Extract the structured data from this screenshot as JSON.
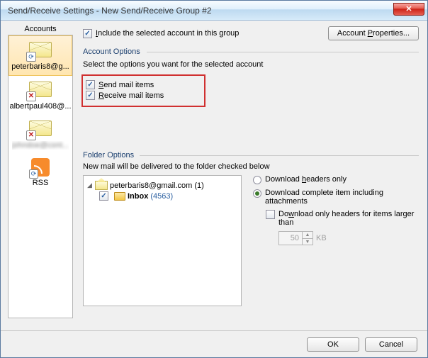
{
  "window": {
    "title": "Send/Receive Settings - New Send/Receive Group #2"
  },
  "sidebar": {
    "header": "Accounts",
    "items": [
      {
        "label": "peterbaris8@g...",
        "selected": true,
        "badge": "refresh"
      },
      {
        "label": "albertpaul408@...",
        "selected": false,
        "badge": "error"
      },
      {
        "label": "johndoe@cont...",
        "selected": false,
        "badge": "error",
        "blurred": true
      },
      {
        "label": "RSS",
        "selected": false,
        "icon": "rss"
      }
    ]
  },
  "main": {
    "include_label": "Include the selected account in this group",
    "include_checked": true,
    "account_properties_btn": "Account Properties...",
    "account_options": {
      "title": "Account Options",
      "desc": "Select the options you want for the selected account",
      "send_label": "Send mail items",
      "send_checked": true,
      "receive_label": "Receive mail items",
      "receive_checked": true
    },
    "folder_options": {
      "title": "Folder Options",
      "desc": "New mail will be delivered to the folder checked below",
      "tree": {
        "root_label": "peterbaris8@gmail.com",
        "root_count": "(1)",
        "inbox_label": "Inbox",
        "inbox_count": "(4563)",
        "inbox_checked": true
      },
      "download": {
        "headers_only": "Download headers only",
        "complete": "Download complete item including attachments",
        "selected": "complete",
        "limit_label": "Download only headers for items larger than",
        "limit_checked": false,
        "limit_value": "50",
        "limit_unit": "KB"
      }
    }
  },
  "footer": {
    "ok": "OK",
    "cancel": "Cancel"
  }
}
